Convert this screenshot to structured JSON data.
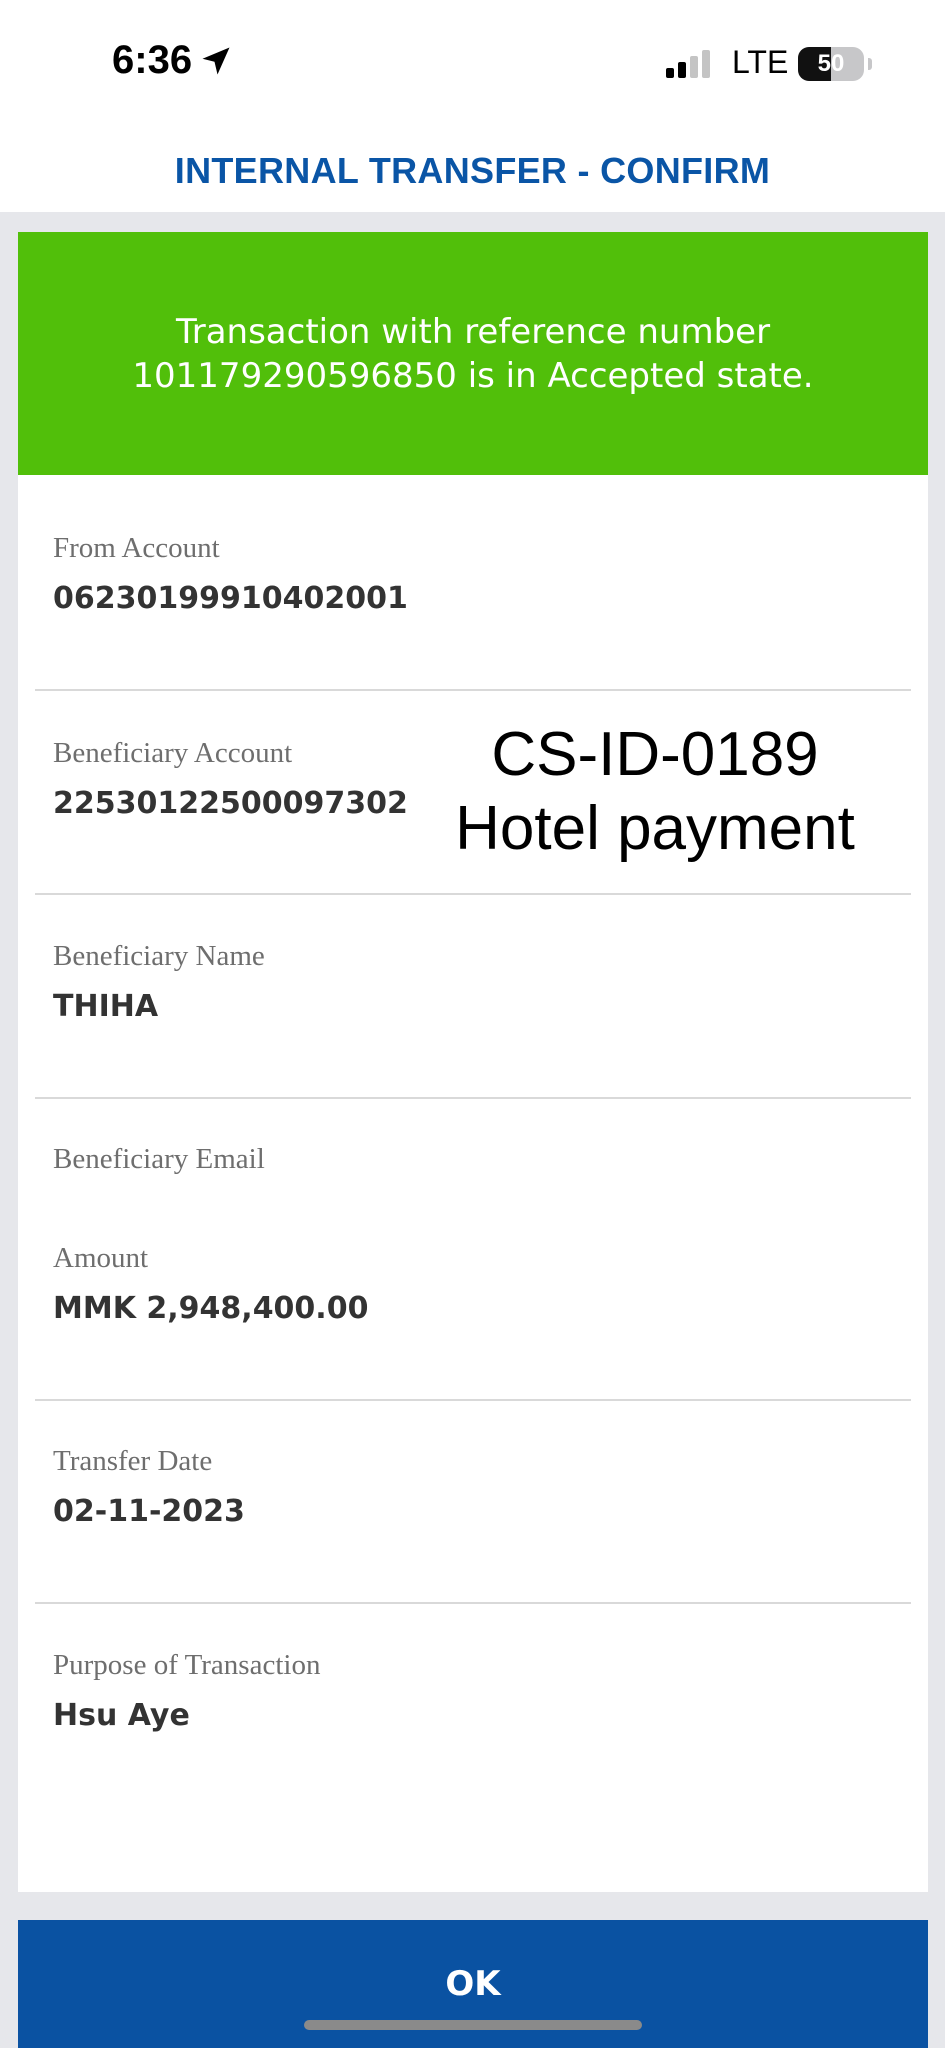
{
  "status_bar": {
    "time": "6:36",
    "network": "LTE",
    "battery": "50",
    "battery_level": 0.5,
    "icons": [
      "location-arrow-icon",
      "signal-bars-icon",
      "battery-icon"
    ]
  },
  "header": {
    "title": "INTERNAL TRANSFER - CONFIRM"
  },
  "banner": {
    "message": "Transaction with reference  number 101179290596850 is in Accepted state.",
    "color": "#51bf0a"
  },
  "fields": {
    "from_account": {
      "label": "From Account",
      "value": "06230199910402001"
    },
    "beneficiary_account": {
      "label": "Beneficiary Account",
      "value": "22530122500097302"
    },
    "beneficiary_name": {
      "label": "Beneficiary Name",
      "value": "THIHA"
    },
    "beneficiary_email": {
      "label": "Beneficiary Email",
      "value": ""
    },
    "amount": {
      "label": "Amount",
      "value": "MMK 2,948,400.00"
    },
    "transfer_date": {
      "label": "Transfer Date",
      "value": "02-11-2023"
    },
    "purpose": {
      "label": "Purpose of Transaction",
      "value": "Hsu Aye"
    }
  },
  "annotation": {
    "line1": "CS-ID-0189",
    "line2": "Hotel payment"
  },
  "ok_button": {
    "label": "OK",
    "color": "#0a52a2"
  },
  "colors": {
    "title_blue": "#0a55a6",
    "background": "#e6e7eb"
  }
}
